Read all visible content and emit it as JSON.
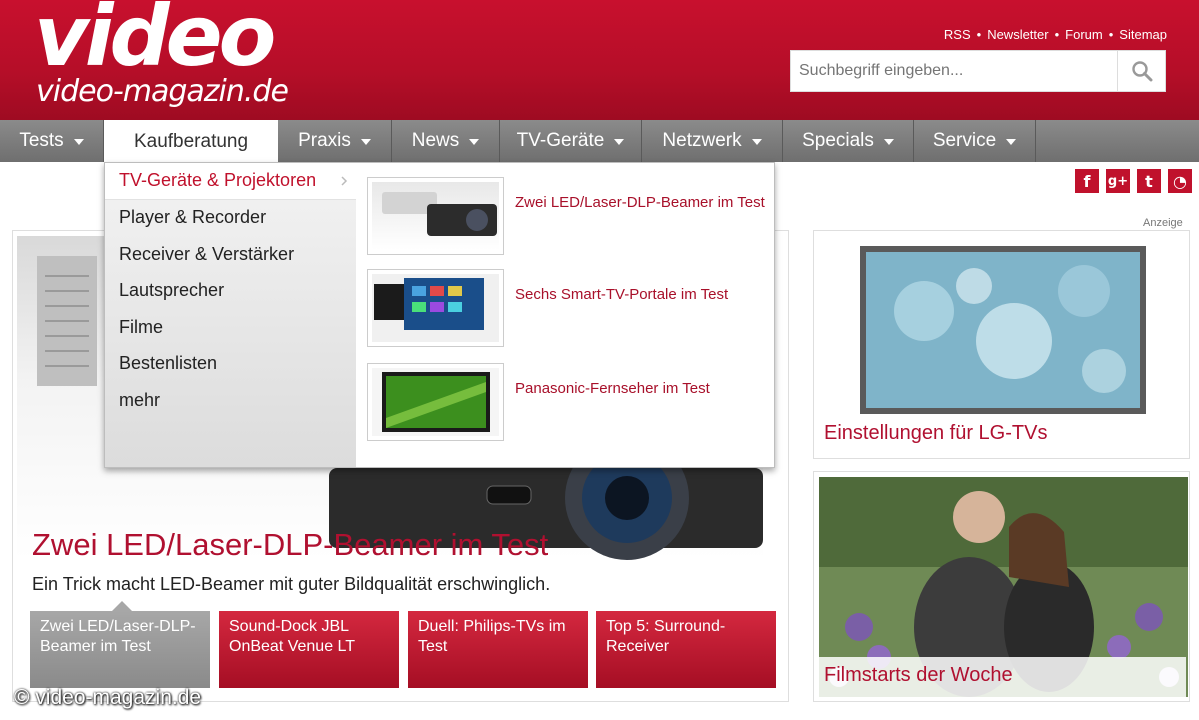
{
  "header": {
    "logo_main": "video",
    "logo_sub": "video-magazin.de",
    "top_links": [
      "RSS",
      "Newsletter",
      "Forum",
      "Sitemap"
    ],
    "search_placeholder": "Suchbegriff eingeben..."
  },
  "nav": {
    "items": [
      {
        "label": "Tests",
        "has_caret": true
      },
      {
        "label": "Kaufberatung",
        "active": true
      },
      {
        "label": "Praxis",
        "has_caret": true
      },
      {
        "label": "News",
        "has_caret": true
      },
      {
        "label": "TV-Geräte",
        "has_caret": true
      },
      {
        "label": "Netzwerk",
        "has_caret": true
      },
      {
        "label": "Specials",
        "has_caret": true
      },
      {
        "label": "Service",
        "has_caret": true
      }
    ]
  },
  "dropdown": {
    "categories": [
      "TV-Geräte & Projektoren",
      "Player & Recorder",
      "Receiver & Verstärker",
      "Lautsprecher",
      "Filme",
      "Bestenlisten",
      "mehr"
    ],
    "articles": [
      {
        "title": "Zwei LED/Laser-DLP-Beamer im Test"
      },
      {
        "title": "Sechs Smart-TV-Portale im Test"
      },
      {
        "title": "Panasonic-Fernseher im Test"
      }
    ]
  },
  "hero": {
    "title": "Zwei LED/Laser-DLP-Beamer im Test",
    "subtitle": "Ein Trick macht LED-Beamer mit guter Bildqualität erschwinglich.",
    "teasers": [
      "Zwei LED/Laser-DLP-Beamer im Test",
      "Sound-Dock JBL OnBeat Venue LT",
      "Duell: Philips-TVs im Test",
      "Top 5: Surround-Receiver"
    ]
  },
  "social": {
    "icons": [
      "facebook-icon",
      "google-plus-icon",
      "twitter-icon",
      "rss-icon"
    ],
    "glyphs": [
      "f",
      "g+",
      "t",
      "◔"
    ]
  },
  "sidebar": {
    "ad_label": "Anzeige",
    "box1_caption": "Einstellungen für LG-TVs",
    "box2_caption": "Filmstarts der Woche"
  },
  "copyright": "© video-magazin.de",
  "colors": {
    "brand_red": "#c8102e",
    "link_red": "#a8102a",
    "nav_gray": "#7a7a7a"
  }
}
